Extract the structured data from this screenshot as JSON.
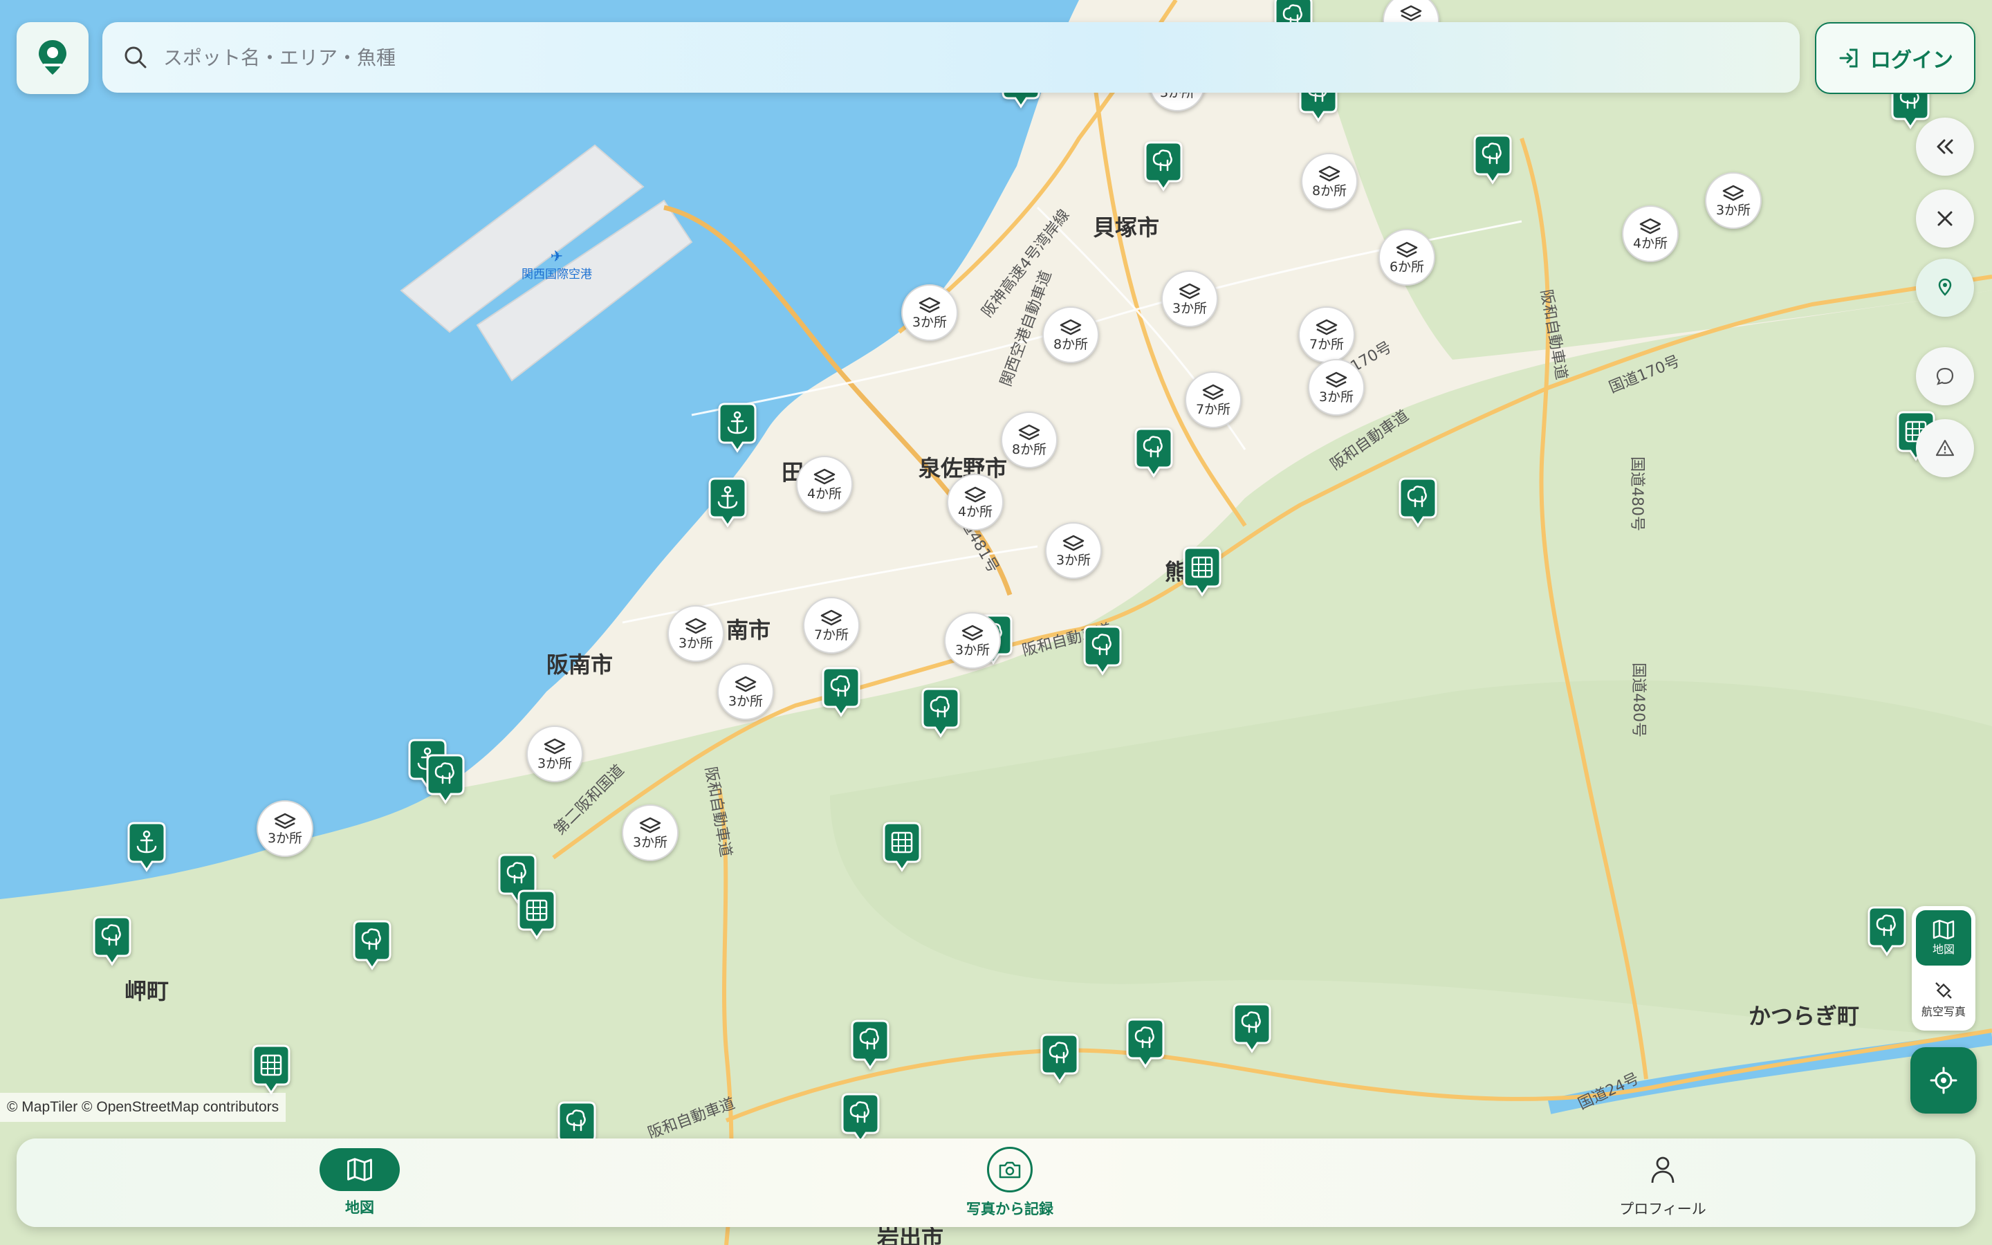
{
  "app": {
    "name": "fishing spot map"
  },
  "search": {
    "placeholder": "スポット名・エリア・魚種"
  },
  "header": {
    "login_label": "ログイン"
  },
  "map_controls": {
    "collapse_icon": "chevrons-left-icon",
    "close_icon": "close-icon",
    "layer_map_label": "地図",
    "layer_aerial_label": "航空写真"
  },
  "map": {
    "attribution": "© MapTiler © OpenStreetMap contributors",
    "place_labels": [
      "貝塚市",
      "泉佐野市",
      "田",
      "南市",
      "阪南市",
      "熊",
      "岬町",
      "かつらぎ町",
      "岩出市"
    ],
    "poi_labels": [
      "関西国際空港"
    ],
    "road_labels": [
      "阪神高速4号湾岸線",
      "関西空港自動車道",
      "阪和自動車道",
      "国道170号",
      "国道170号",
      "国道480号",
      "国道480号",
      "国道481号",
      "第二阪和国道",
      "阪和自動車道",
      "国道24号",
      "阪和自動車道",
      "阪和自動車道",
      "阪和自動車道"
    ],
    "clusters": [
      "3か所",
      "3か所",
      "8か所",
      "6か所",
      "4か所",
      "3か所",
      "3か所",
      "8か所",
      "7か所",
      "7か所",
      "4か所",
      "8か所",
      "4か所",
      "3か所",
      "7か所",
      "3か所",
      "3か所",
      "3か所",
      "3か所",
      "3か所",
      "3か所",
      "3か所",
      "3か所"
    ],
    "marker_types": [
      "anchor-pin-icon",
      "tree-pin-icon",
      "pier-pin-icon"
    ],
    "colors": {
      "sea": "#7ec6ef",
      "land": "#f4f1e6",
      "forest": "#d9e8c7",
      "road": "#f7c56a",
      "brand": "#0e7a55"
    }
  },
  "bottom_nav": {
    "tabs": [
      {
        "label": "地図",
        "icon": "map-icon",
        "active": true
      },
      {
        "label": "写真から記録",
        "icon": "camera-icon",
        "active": false
      },
      {
        "label": "プロフィール",
        "icon": "person-icon",
        "active": false
      }
    ]
  }
}
